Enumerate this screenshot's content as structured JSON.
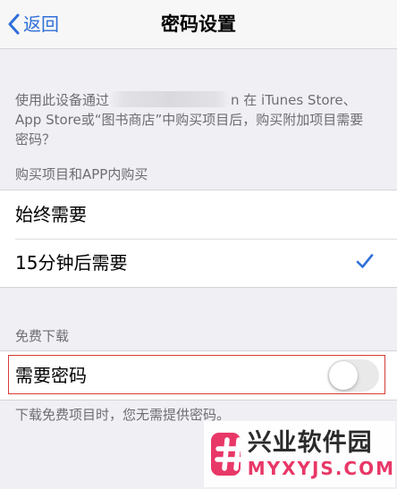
{
  "nav": {
    "back_label": "返回",
    "title": "密码设置"
  },
  "description": {
    "line1_before": "使用此设备通过",
    "line1_after": "n 在 iTunes Store、",
    "line2": "App Store或“图书商店”中购买项目后，购买附加项目需要",
    "line3": "密码？"
  },
  "purchase_section": {
    "header": "购买项目和APP内购买",
    "options": [
      {
        "label": "始终需要",
        "selected": false
      },
      {
        "label": "15分钟后需要",
        "selected": true
      }
    ]
  },
  "free_section": {
    "header": "免费下载",
    "require_password_label": "需要密码",
    "require_password_on": false,
    "footer": "下载免费项目时，您无需提供密码。"
  },
  "colors": {
    "accent": "#2f6fd8",
    "highlight_border": "#d63a3a",
    "toggle_off": "#e9e9ea",
    "watermark_accent": "#e83868"
  },
  "icons": {
    "back": "chevron-left-icon",
    "selected": "checkmark-icon",
    "watermark": "hash-logo-icon"
  },
  "watermark": {
    "title": "兴业软件园",
    "site": "MYXYJS.COM"
  }
}
